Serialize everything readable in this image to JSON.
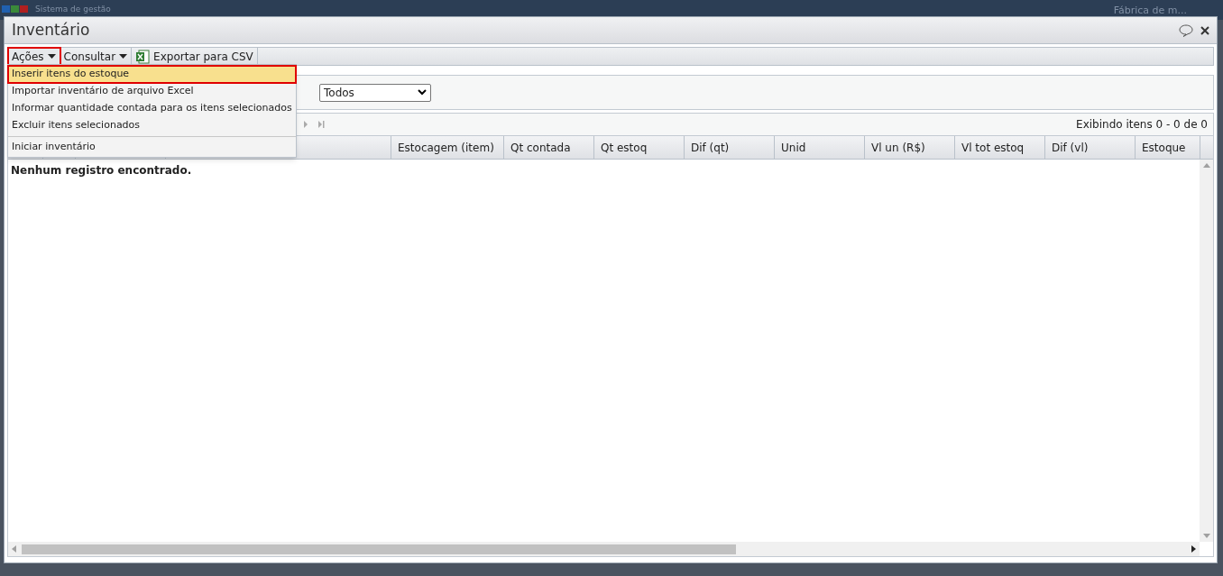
{
  "background_app": {
    "title": "Sistema de gestão",
    "company": "Fábrica de m..."
  },
  "window": {
    "title": "Inventário"
  },
  "toolbar": [
    {
      "label": "Ações",
      "kind": "dropdown",
      "outlined": true,
      "expanded": true
    },
    {
      "label": "Consultar",
      "kind": "dropdown",
      "outlined": false,
      "expanded": false
    },
    {
      "label": "Exportar para CSV",
      "kind": "excel",
      "outlined": false,
      "expanded": false
    }
  ],
  "menu": [
    {
      "label": "Inserir itens do estoque",
      "selected": true,
      "outlined": true,
      "separator_before": false
    },
    {
      "label": "Importar inventário de arquivo Excel",
      "selected": false,
      "outlined": false,
      "separator_before": false
    },
    {
      "label": "Informar quantidade contada para os itens selecionados",
      "selected": false,
      "outlined": false,
      "separator_before": false
    },
    {
      "label": "Excluir itens selecionados",
      "selected": false,
      "outlined": false,
      "separator_before": false
    },
    {
      "label": "Iniciar inventário",
      "selected": false,
      "outlined": false,
      "separator_before": true
    }
  ],
  "filter": {
    "value": "Todos"
  },
  "pager": {
    "status": "Exibindo itens 0 - 0 de 0"
  },
  "table": {
    "columns": [
      "",
      "",
      "",
      "",
      "Estocagem (item)",
      "Qt contada",
      "Qt estoq",
      "Dif (qt)",
      "Unid",
      "Vl un (R$)",
      "Vl tot estoq",
      "Dif (vl)",
      "Estoque"
    ],
    "empty_message": "Nenhum registro encontrado."
  }
}
